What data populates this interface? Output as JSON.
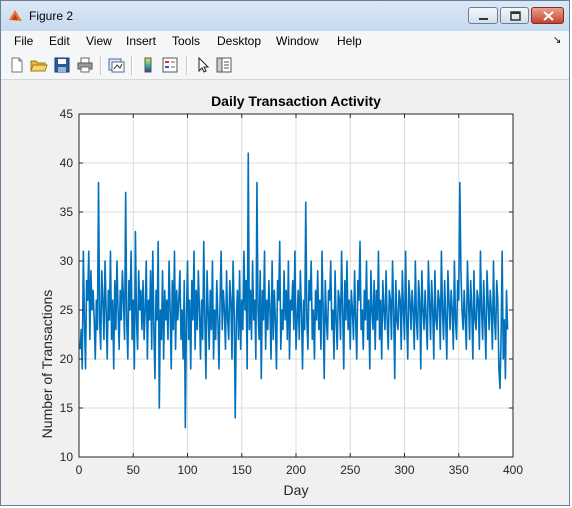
{
  "window": {
    "title": "Figure 2"
  },
  "menu": [
    "File",
    "Edit",
    "View",
    "Insert",
    "Tools",
    "Desktop",
    "Window",
    "Help"
  ],
  "toolbar": [
    "new-figure-icon",
    "open-file-icon",
    "save-icon",
    "print-icon",
    "link-plot-icon",
    "insert-colorbar-icon",
    "insert-legend-icon",
    "edit-plot-pointer-icon",
    "property-inspector-icon"
  ],
  "colors": {
    "line": "#0072bd",
    "axes_bg": "#ffffff",
    "grid": "#dcdcdc",
    "figure_bg": "#f0f0f0"
  },
  "chart_data": {
    "type": "line",
    "title": "Daily Transaction Activity",
    "xlabel": "Day",
    "ylabel": "Number of Transactions",
    "xlim": [
      0,
      400
    ],
    "ylim": [
      10,
      45
    ],
    "xticks": [
      0,
      50,
      100,
      150,
      200,
      250,
      300,
      350,
      400
    ],
    "yticks": [
      10,
      15,
      20,
      25,
      30,
      35,
      40,
      45
    ],
    "grid": true,
    "series": [
      {
        "x_start": 1,
        "x_step": 1,
        "values": [
          21,
          23,
          19,
          31,
          24,
          19,
          28,
          26,
          31,
          22,
          29,
          25,
          27,
          24,
          20,
          26,
          23,
          38,
          24,
          21,
          29,
          26,
          22,
          30,
          25,
          20,
          27,
          24,
          31,
          22,
          26,
          19,
          28,
          23,
          30,
          25,
          21,
          27,
          24,
          29,
          26,
          22,
          37,
          24,
          20,
          28,
          25,
          31,
          22,
          26,
          19,
          33,
          24,
          21,
          29,
          25,
          27,
          23,
          28,
          22,
          25,
          30,
          20,
          26,
          24,
          29,
          21,
          31,
          23,
          18,
          27,
          24,
          32,
          15,
          25,
          22,
          29,
          20,
          27,
          24,
          26,
          22,
          30,
          25,
          19,
          28,
          23,
          31,
          21,
          27,
          24,
          26,
          29,
          22,
          25,
          20,
          28,
          13,
          24,
          30,
          22,
          26,
          19,
          28,
          24,
          31,
          21,
          27,
          23,
          29,
          25,
          20,
          26,
          22,
          32,
          24,
          18,
          29,
          25,
          21,
          27,
          23,
          30,
          20,
          25,
          22,
          28,
          24,
          19,
          26,
          31,
          23,
          27,
          25,
          21,
          29,
          24,
          22,
          28,
          26,
          20,
          30,
          25,
          14,
          24,
          27,
          22,
          29,
          21,
          26,
          23,
          31,
          25,
          28,
          19,
          41,
          23,
          27,
          22,
          30,
          24,
          26,
          20,
          38,
          25,
          22,
          29,
          18,
          27,
          24,
          31,
          21,
          26,
          23,
          28,
          25,
          20,
          30,
          22,
          27,
          24,
          19,
          28,
          26,
          32,
          21,
          25,
          23,
          29,
          24,
          27,
          22,
          30,
          20,
          26,
          25,
          28,
          23,
          31,
          21,
          24,
          27,
          22,
          29,
          25,
          19,
          26,
          23,
          36,
          24,
          21,
          28,
          26,
          30,
          22,
          25,
          20,
          27,
          24,
          29,
          23,
          26,
          21,
          31,
          25,
          18,
          28,
          24,
          22,
          27,
          26,
          30,
          23,
          25,
          20,
          29,
          24,
          21,
          27,
          26,
          22,
          31,
          25,
          19,
          28,
          24,
          30,
          23,
          26,
          21,
          27,
          25,
          22,
          29,
          24,
          20,
          28,
          26,
          32,
          23,
          25,
          21,
          27,
          24,
          30,
          22,
          26,
          19,
          29,
          25,
          23,
          28,
          21,
          27,
          24,
          31,
          22,
          26,
          20,
          28,
          25,
          23,
          29,
          24,
          21,
          27,
          26,
          22,
          30,
          25,
          18,
          28,
          24,
          23,
          27,
          26,
          21,
          29,
          25,
          22,
          31,
          24,
          20,
          28,
          26,
          23,
          27,
          25,
          21,
          30,
          24,
          22,
          28,
          26,
          19,
          29,
          25,
          23,
          27,
          24,
          21,
          30,
          26,
          22,
          28,
          25,
          20,
          29,
          24,
          23,
          27,
          26,
          21,
          31,
          25,
          22,
          28,
          24,
          20,
          29,
          26,
          23,
          27,
          25,
          21,
          30,
          24,
          22,
          28,
          26,
          38,
          29,
          25,
          23,
          27,
          24,
          21,
          30,
          26,
          22,
          28,
          25,
          20,
          29,
          24,
          23,
          27,
          26,
          21,
          31,
          25,
          22,
          28,
          24,
          20,
          29,
          26,
          23,
          27,
          25,
          21,
          30,
          24,
          22,
          28,
          26,
          19,
          17,
          22,
          31,
          20,
          24,
          18,
          27,
          23
        ]
      }
    ]
  }
}
